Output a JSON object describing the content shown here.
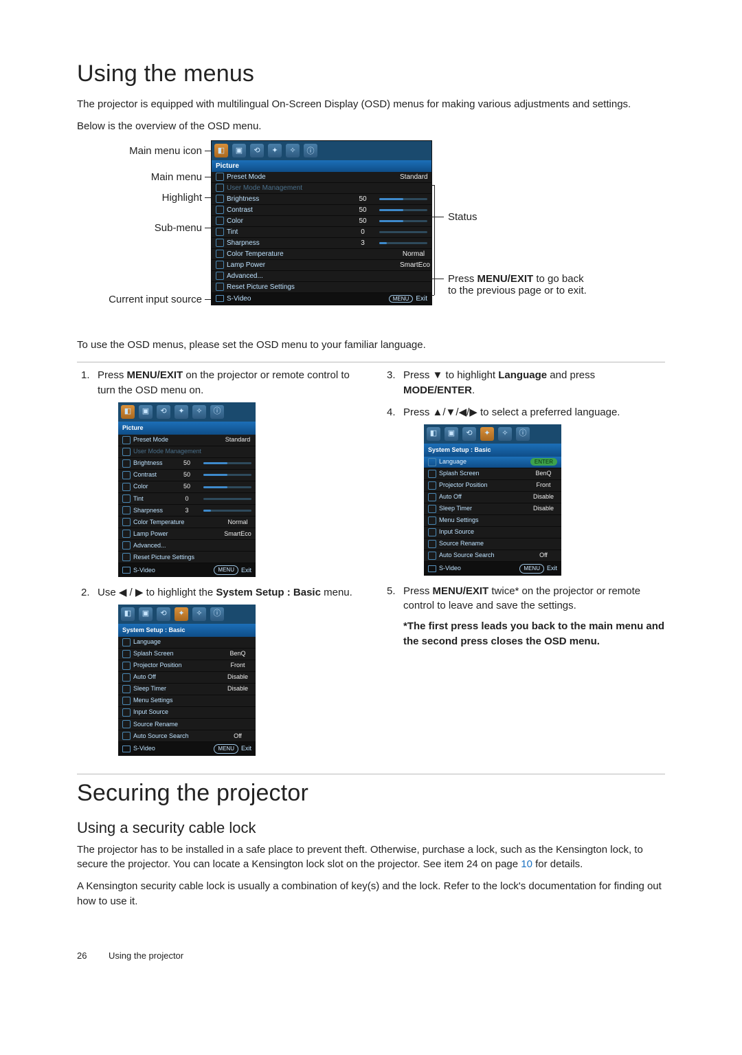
{
  "page_number": "26",
  "footer_text": "Using the projector",
  "sec1": {
    "title": "Using the menus",
    "intro1": "The projector is equipped with multilingual On-Screen Display (OSD) menus for making various adjustments and settings.",
    "intro2": "Below is the overview of the OSD menu.",
    "labels": {
      "main_icon": "Main menu icon",
      "main_menu": "Main menu",
      "highlight": "Highlight",
      "sub_menu": "Sub-menu",
      "current_source": "Current input source",
      "status": "Status",
      "press_menu": "Press ",
      "press_menu_b": "MENU/EXIT",
      "press_menu2": " to go back to the previous page or to exit."
    },
    "osd_main": {
      "title": "Picture",
      "rows": [
        {
          "label": "Preset Mode",
          "val": "Standard",
          "bar": null
        },
        {
          "label": "User Mode Management",
          "val": "",
          "bar": null,
          "dim": true
        },
        {
          "label": "Brightness",
          "val": "50",
          "bar": 50
        },
        {
          "label": "Contrast",
          "val": "50",
          "bar": 50
        },
        {
          "label": "Color",
          "val": "50",
          "bar": 50
        },
        {
          "label": "Tint",
          "val": "0",
          "bar": 0
        },
        {
          "label": "Sharpness",
          "val": "3",
          "bar": 15
        },
        {
          "label": "Color Temperature",
          "val": "Normal",
          "bar": null
        },
        {
          "label": "Lamp Power",
          "val": "SmartEco",
          "bar": null
        },
        {
          "label": "Advanced...",
          "val": "",
          "bar": null
        },
        {
          "label": "Reset Picture Settings",
          "val": "",
          "bar": null
        }
      ],
      "source": "S-Video",
      "exit": "Exit",
      "menu_btn": "MENU"
    },
    "after_diagram": "To use the OSD menus, please set the OSD menu to your familiar language.",
    "steps_left": {
      "s1a": "Press ",
      "s1b": "MENU/EXIT",
      "s1c": " on the projector or remote control to turn the OSD menu on.",
      "s2a": "Use ",
      "s2b": " / ",
      "s2c": " to highlight the ",
      "s2d": "System Setup : Basic",
      "s2e": " menu."
    },
    "steps_right": {
      "s3a": "Press ",
      "s3b": " to highlight ",
      "s3c": "Language",
      "s3d": " and press ",
      "s3e": "MODE/ENTER",
      "s3f": ".",
      "s4a": "Press ",
      "s4b": " to select a preferred language.",
      "s5a": "Press ",
      "s5b": "MENU/EXIT",
      "s5c": " twice* on the projector or remote control to leave and save the settings.",
      "note": "*The first press leads you back to the main menu and the second press closes the OSD menu."
    },
    "osd_sys": {
      "title": "System Setup : Basic",
      "rows": [
        {
          "label": "Language",
          "val": ""
        },
        {
          "label": "Splash Screen",
          "val": "BenQ"
        },
        {
          "label": "Projector Position",
          "val": "Front"
        },
        {
          "label": "Auto Off",
          "val": "Disable"
        },
        {
          "label": "Sleep Timer",
          "val": "Disable"
        },
        {
          "label": "Menu Settings",
          "val": ""
        },
        {
          "label": "Input Source",
          "val": ""
        },
        {
          "label": "Source Rename",
          "val": ""
        },
        {
          "label": "Auto Source Search",
          "val": "Off"
        }
      ],
      "source": "S-Video",
      "exit": "Exit",
      "menu_btn": "MENU"
    },
    "osd_sys_enter": {
      "title": "System Setup : Basic",
      "highlight_index": 0,
      "enter_label": "ENTER",
      "rows": [
        {
          "label": "Language",
          "val": ""
        },
        {
          "label": "Splash Screen",
          "val": "BenQ"
        },
        {
          "label": "Projector Position",
          "val": "Front"
        },
        {
          "label": "Auto Off",
          "val": "Disable"
        },
        {
          "label": "Sleep Timer",
          "val": "Disable"
        },
        {
          "label": "Menu Settings",
          "val": ""
        },
        {
          "label": "Input Source",
          "val": ""
        },
        {
          "label": "Source Rename",
          "val": ""
        },
        {
          "label": "Auto Source Search",
          "val": "Off"
        }
      ],
      "source": "S-Video",
      "exit": "Exit",
      "menu_btn": "MENU"
    }
  },
  "sec2": {
    "title": "Securing the projector",
    "sub": "Using a security cable lock",
    "p1a": "The projector has to be installed in a safe place to prevent theft. Otherwise, purchase a lock, such as the Kensington lock, to secure the projector. You can locate a Kensington lock slot on the projector. See item 24 on page ",
    "p1link": "10",
    "p1b": " for details.",
    "p2": "A Kensington security cable lock is usually a combination of key(s) and the lock. Refer to the lock's documentation for finding out how to use it."
  },
  "glyphs": {
    "left": "◀",
    "right": "▶",
    "up": "▲",
    "down": "▼"
  }
}
